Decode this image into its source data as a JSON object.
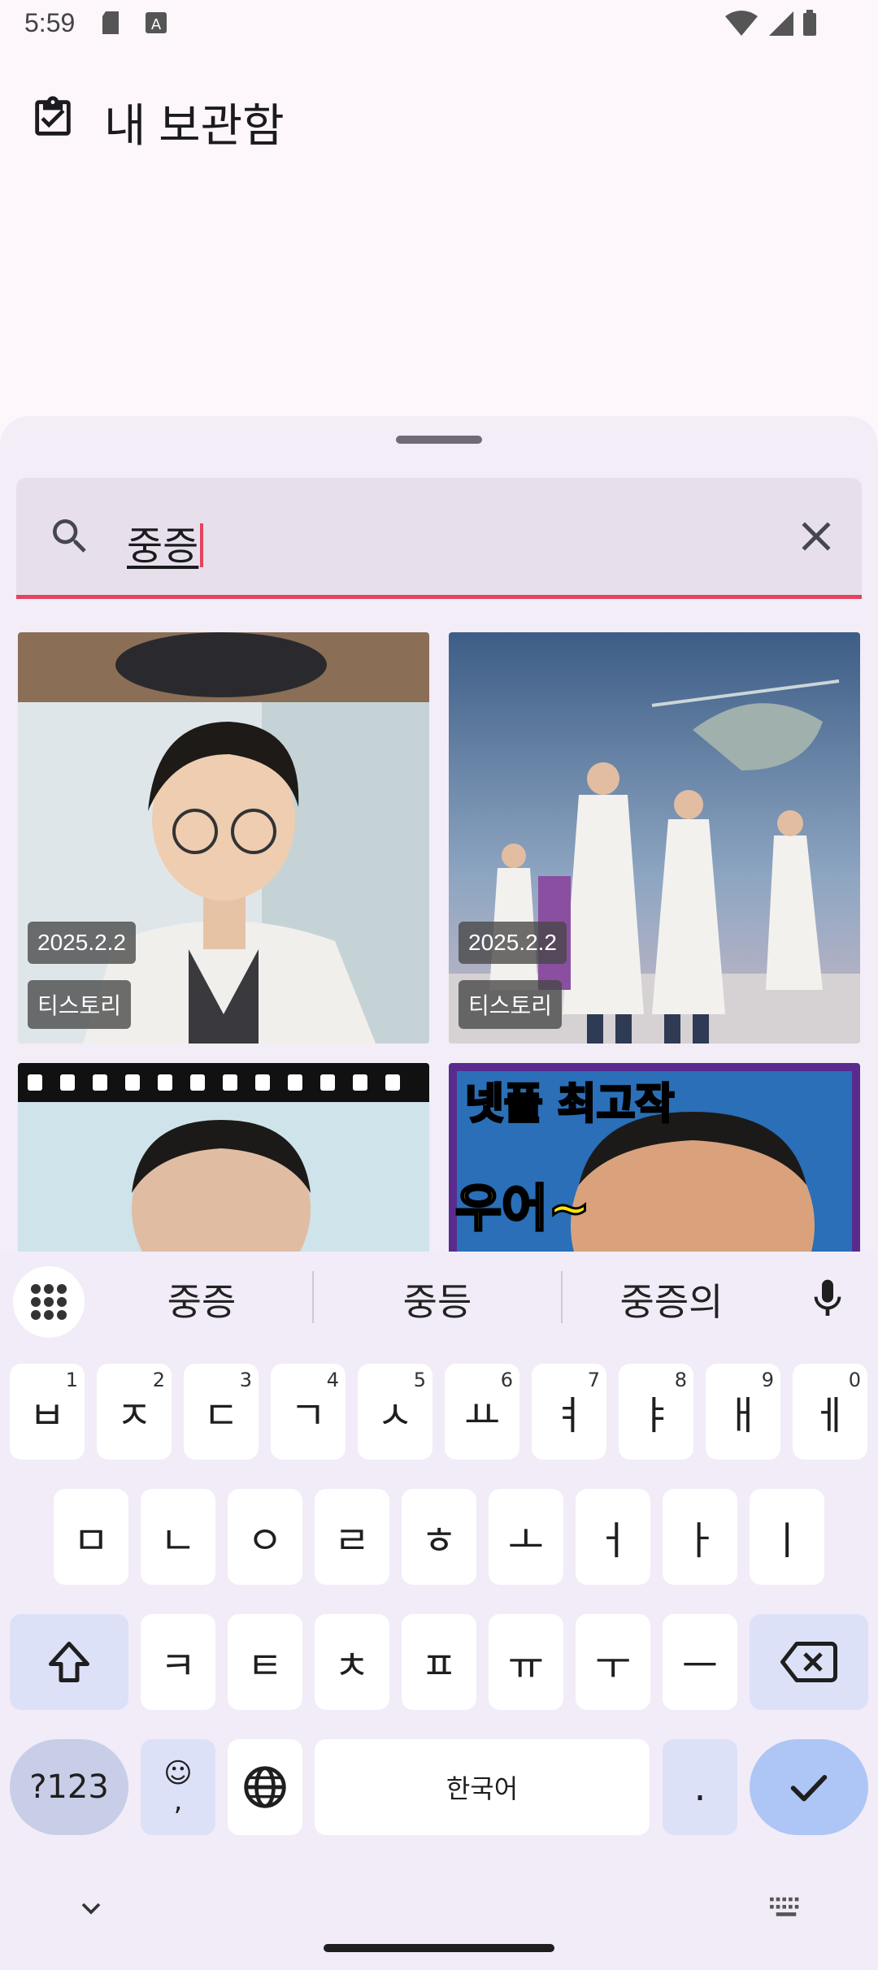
{
  "status_bar": {
    "time": "5:59"
  },
  "app_bar": {
    "title": "내 보관함"
  },
  "search": {
    "query": "중증"
  },
  "results": [
    {
      "date": "2025.2.2",
      "source": "티스토리"
    },
    {
      "date": "2025.2.2",
      "source": "티스토리"
    },
    {
      "text_overlay": ""
    },
    {
      "text_overlay": "넷플 최고작",
      "text_overlay_2": "우어~"
    }
  ],
  "keyboard": {
    "suggestions": [
      "중증",
      "중등",
      "중증의"
    ],
    "row1": [
      {
        "k": "ㅂ",
        "n": "1"
      },
      {
        "k": "ㅈ",
        "n": "2"
      },
      {
        "k": "ㄷ",
        "n": "3"
      },
      {
        "k": "ㄱ",
        "n": "4"
      },
      {
        "k": "ㅅ",
        "n": "5"
      },
      {
        "k": "ㅛ",
        "n": "6"
      },
      {
        "k": "ㅕ",
        "n": "7"
      },
      {
        "k": "ㅑ",
        "n": "8"
      },
      {
        "k": "ㅐ",
        "n": "9"
      },
      {
        "k": "ㅔ",
        "n": "0"
      }
    ],
    "row2": [
      "ㅁ",
      "ㄴ",
      "ㅇ",
      "ㄹ",
      "ㅎ",
      "ㅗ",
      "ㅓ",
      "ㅏ",
      "ㅣ"
    ],
    "row3": [
      "ㅋ",
      "ㅌ",
      "ㅊ",
      "ㅍ",
      "ㅠ",
      "ㅜ",
      "ㅡ"
    ],
    "symbols_label": "?123",
    "emoji_label": "☺\n,",
    "space_label": "한국어",
    "period_label": "."
  },
  "colors": {
    "accent": "#e5435f",
    "sheet": "#f3edf7",
    "key_func": "#dde1f8",
    "enter": "#aec6f5"
  }
}
